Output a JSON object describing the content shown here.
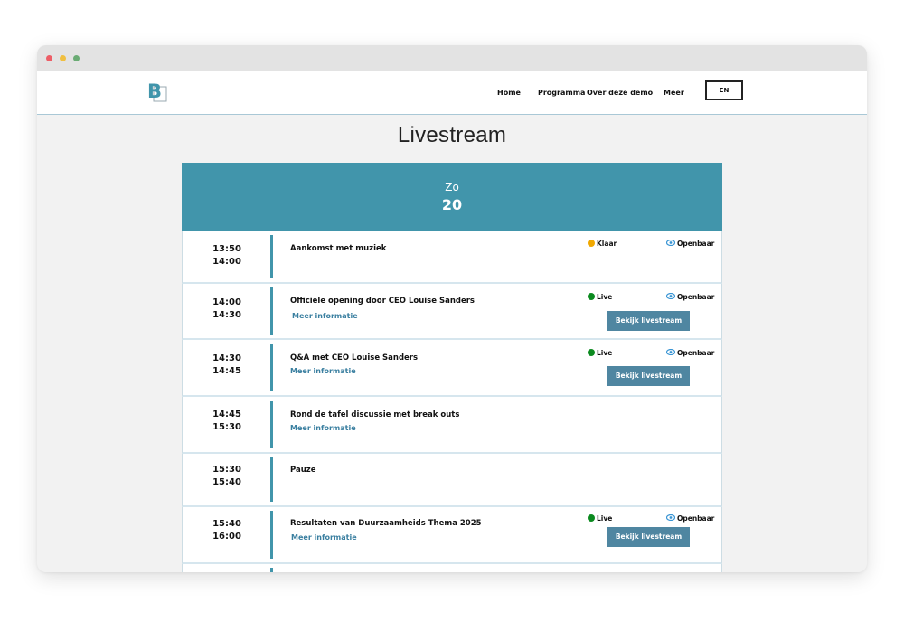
{
  "nav": {
    "logo_letter": "B",
    "links": [
      "Home",
      "Programma",
      "Over deze demo",
      "Meer"
    ],
    "language": "EN"
  },
  "page": {
    "title": "Livestream"
  },
  "day": {
    "name": "Zo",
    "number": "20"
  },
  "labels": {
    "more_info": "Meer informatie",
    "watch": "Bekijk livestream"
  },
  "colors": {
    "accent": "#4195ab",
    "button": "#4f86a1",
    "status_ready": "#f0a800",
    "status_live": "#0b8a1f",
    "visibility_eye": "#3a95d4"
  },
  "events": [
    {
      "start": "13:50",
      "end": "14:00",
      "title": "Aankomst met muziek",
      "status": "Klaar",
      "visibility": "Openbaar"
    },
    {
      "start": "14:00",
      "end": "14:30",
      "title": "Officiele opening door CEO Louise Sanders",
      "status": "Live",
      "visibility": "Openbaar"
    },
    {
      "start": "14:30",
      "end": "14:45",
      "title": "Q&A met CEO Louise Sanders",
      "status": "Live",
      "visibility": "Openbaar"
    },
    {
      "start": "14:45",
      "end": "15:30",
      "title": "Rond de tafel discussie met break outs"
    },
    {
      "start": "15:30",
      "end": "15:40",
      "title": "Pauze"
    },
    {
      "start": "15:40",
      "end": "16:00",
      "title": "Resultaten van Duurzaamheids Thema 2025",
      "status": "Live",
      "visibility": "Openbaar"
    }
  ]
}
